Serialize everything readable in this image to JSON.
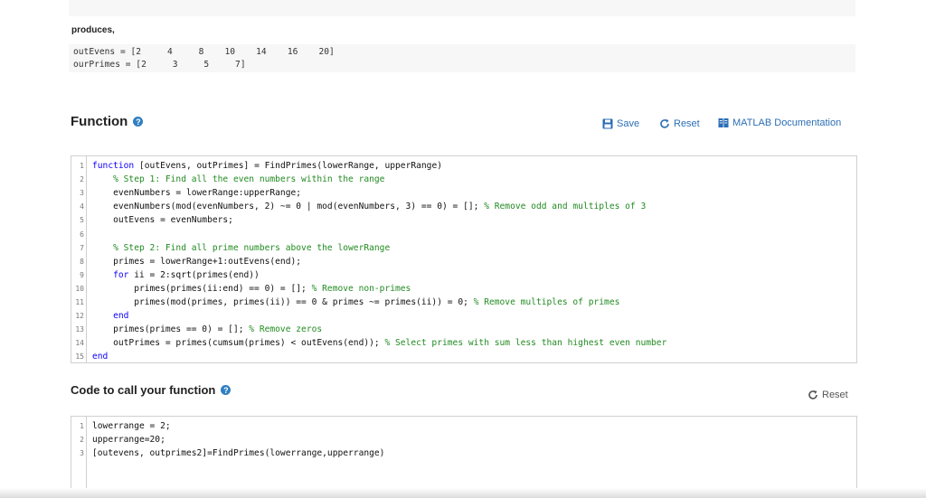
{
  "example": {
    "produces_label": "produces,",
    "output_lines": [
      "outEvens = [2     4     8    10    14    16    20]",
      "ourPrimes = [2     3     5     7]"
    ]
  },
  "function_section": {
    "title": "Function",
    "toolbar": {
      "save_label": "Save",
      "reset_label": "Reset",
      "doc_label": "MATLAB Documentation"
    },
    "code_lines": [
      {
        "n": "1",
        "segs": [
          {
            "t": "function",
            "c": "kw"
          },
          {
            "t": " [outEvens, outPrimes] = FindPrimes(lowerRange, upperRange)",
            "c": ""
          }
        ]
      },
      {
        "n": "2",
        "segs": [
          {
            "t": "    ",
            "c": ""
          },
          {
            "t": "% Step 1: Find all the even numbers within the range",
            "c": "cm"
          }
        ]
      },
      {
        "n": "3",
        "segs": [
          {
            "t": "    evenNumbers = lowerRange:upperRange;",
            "c": ""
          }
        ]
      },
      {
        "n": "4",
        "segs": [
          {
            "t": "    evenNumbers(mod(evenNumbers, 2) ~= 0 | mod(evenNumbers, 3) == 0) = []; ",
            "c": ""
          },
          {
            "t": "% Remove odd and multiples of 3",
            "c": "cm"
          }
        ]
      },
      {
        "n": "5",
        "segs": [
          {
            "t": "    outEvens = evenNumbers;",
            "c": ""
          }
        ]
      },
      {
        "n": "6",
        "segs": [
          {
            "t": "",
            "c": ""
          }
        ]
      },
      {
        "n": "7",
        "segs": [
          {
            "t": "    ",
            "c": ""
          },
          {
            "t": "% Step 2: Find all prime numbers above the lowerRange",
            "c": "cm"
          }
        ]
      },
      {
        "n": "8",
        "segs": [
          {
            "t": "    primes = lowerRange+1:outEvens(end);",
            "c": ""
          }
        ]
      },
      {
        "n": "9",
        "segs": [
          {
            "t": "    ",
            "c": ""
          },
          {
            "t": "for",
            "c": "kw"
          },
          {
            "t": " ii = 2:sqrt(primes(end))",
            "c": ""
          }
        ]
      },
      {
        "n": "10",
        "segs": [
          {
            "t": "        primes(primes(ii:end) == 0) = []; ",
            "c": ""
          },
          {
            "t": "% Remove non-primes",
            "c": "cm"
          }
        ]
      },
      {
        "n": "11",
        "segs": [
          {
            "t": "        primes(mod(primes, primes(ii)) == 0 & primes ~= primes(ii)) = 0; ",
            "c": ""
          },
          {
            "t": "% Remove multiples of primes",
            "c": "cm"
          }
        ]
      },
      {
        "n": "12",
        "segs": [
          {
            "t": "    ",
            "c": ""
          },
          {
            "t": "end",
            "c": "kw"
          }
        ]
      },
      {
        "n": "13",
        "segs": [
          {
            "t": "    primes(primes == 0) = []; ",
            "c": ""
          },
          {
            "t": "% Remove zeros",
            "c": "cm"
          }
        ]
      },
      {
        "n": "14",
        "segs": [
          {
            "t": "    outPrimes = primes(cumsum(primes) < outEvens(end)); ",
            "c": ""
          },
          {
            "t": "% Select primes with sum less than highest even number",
            "c": "cm"
          }
        ]
      },
      {
        "n": "15",
        "segs": [
          {
            "t": "end",
            "c": "kw"
          }
        ]
      }
    ]
  },
  "call_section": {
    "title": "Code to call your function",
    "reset_label": "Reset",
    "code_lines": [
      {
        "n": "1",
        "segs": [
          {
            "t": "lowerrange = 2;",
            "c": ""
          }
        ]
      },
      {
        "n": "2",
        "segs": [
          {
            "t": "upperrange=20;",
            "c": ""
          }
        ]
      },
      {
        "n": "3",
        "segs": [
          {
            "t": "[outevens, outprimes2]=FindPrimes(lowerrange,upperrange)",
            "c": ""
          }
        ]
      }
    ]
  },
  "colors": {
    "link": "#2c6eb5",
    "keyword": "#0e00ff",
    "comment": "#228b22",
    "help_icon": "#2f7fc1"
  }
}
